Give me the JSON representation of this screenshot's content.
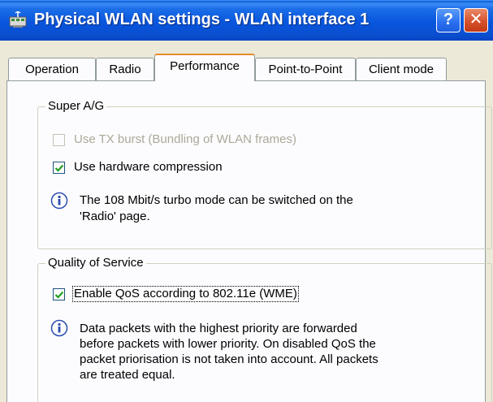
{
  "window": {
    "title": "Physical WLAN settings - WLAN interface 1",
    "icon": "network-adapter-icon",
    "help_glyph": "?",
    "close_glyph": "✕"
  },
  "tabs": [
    {
      "label": "Operation",
      "active": false
    },
    {
      "label": "Radio",
      "active": false
    },
    {
      "label": "Performance",
      "active": true
    },
    {
      "label": "Point-to-Point",
      "active": false
    },
    {
      "label": "Client mode",
      "active": false
    }
  ],
  "super_ag": {
    "title": "Super A/G",
    "tx_burst": {
      "label": "Use TX burst (Bundling of WLAN frames)",
      "checked": false,
      "enabled": false
    },
    "hw_compression": {
      "label": "Use hardware compression",
      "checked": true,
      "enabled": true
    },
    "info_line1": "The 108 Mbit/s turbo mode can be switched on the",
    "info_line2": "'Radio' page."
  },
  "qos": {
    "title": "Quality of Service",
    "enable_qos": {
      "label": "Enable QoS according to 802.11e (WME)",
      "checked": true,
      "enabled": true
    },
    "info_line1": "Data packets with the highest priority are forwarded",
    "info_line2": "before packets with lower priority. On disabled QoS the",
    "info_line3": "packet priorisation is not taken into account. All packets",
    "info_line4": "are treated equal."
  },
  "colors": {
    "titlebar": "#0855dd",
    "dialog_bg": "#ece9d8",
    "tab_active_accent": "#e68b2c",
    "disabled_text": "#aca899"
  }
}
